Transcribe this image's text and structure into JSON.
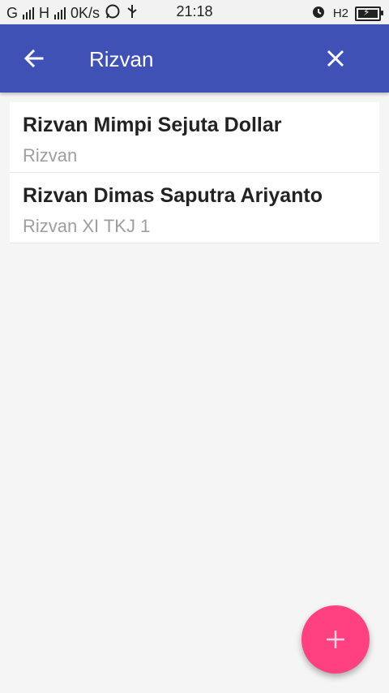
{
  "status_bar": {
    "carrier_text": "G",
    "network_text": "H",
    "speed": "0K/s",
    "time": "21:18",
    "h2_text": "H2"
  },
  "toolbar": {
    "search_value": "Rizvan"
  },
  "contacts": [
    {
      "name": "Rizvan Mimpi Sejuta Dollar",
      "detail": "Rizvan"
    },
    {
      "name": "Rizvan Dimas Saputra Ariyanto",
      "detail": "Rizvan XI TKJ 1"
    }
  ],
  "colors": {
    "app_bar": "#3f51b5",
    "fab": "#ff4081",
    "background": "#f5f5f5"
  },
  "icons": {
    "back": "arrow-left-icon",
    "clear": "close-icon",
    "add": "plus-icon",
    "alarm": "alarm-icon",
    "whatsapp": "whatsapp-icon",
    "usb": "usb-icon",
    "battery": "battery-charging-icon"
  }
}
